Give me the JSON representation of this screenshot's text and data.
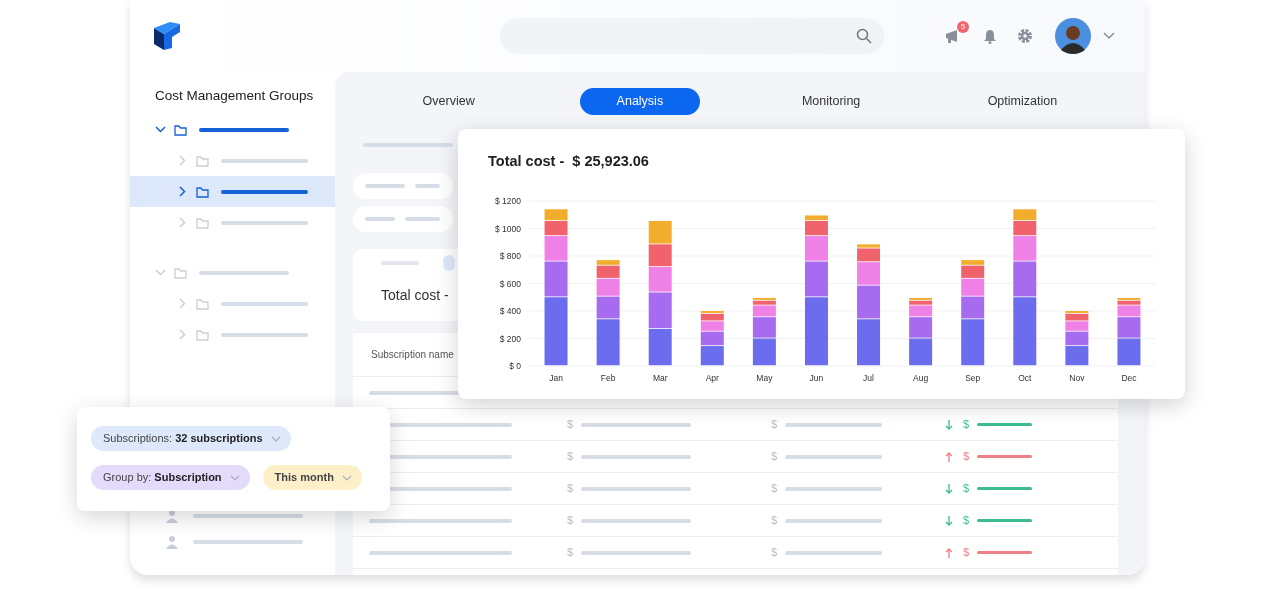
{
  "header": {
    "badge": "5"
  },
  "sidebar": {
    "title": "Cost Management Groups",
    "tree": [
      {
        "expanded": true,
        "selected": false,
        "children": [
          {
            "expanded": false,
            "selected": false
          },
          {
            "expanded": false,
            "selected": true
          },
          {
            "expanded": false,
            "selected": false
          }
        ]
      },
      {
        "expanded": true,
        "selected": false,
        "children": [
          {
            "expanded": false,
            "selected": false
          },
          {
            "expanded": false,
            "selected": false
          }
        ]
      }
    ]
  },
  "tabs": [
    {
      "label": "Overview",
      "selected": false
    },
    {
      "label": "Analysis",
      "selected": true
    },
    {
      "label": "Monitoring",
      "selected": false
    },
    {
      "label": "Optimization",
      "selected": false
    }
  ],
  "summary_card": {
    "title": "Total cost -"
  },
  "table": {
    "columns": [
      "Subscription name"
    ],
    "rows": [
      {
        "kind": "down",
        "cells": [
          "$",
          "$",
          "$"
        ]
      },
      {
        "kind": "up",
        "cells": [
          "$",
          "$",
          "$"
        ]
      },
      {
        "kind": "down",
        "cells": [
          "$",
          "$",
          "$"
        ]
      },
      {
        "kind": "down",
        "cells": [
          "$",
          "$",
          "$"
        ]
      },
      {
        "kind": "up",
        "cells": [
          "$",
          "$",
          "$"
        ]
      }
    ]
  },
  "chart_card": {
    "title": "Total cost -  $ 25,923.06",
    "chart_data": {
      "type": "bar",
      "stacked": true,
      "grid": true,
      "categories": [
        "Jan",
        "Feb",
        "Mar",
        "Apr",
        "May",
        "Jun",
        "Jul",
        "Aug",
        "Sep",
        "Oct",
        "Nov",
        "Dec"
      ],
      "ylim": [
        0,
        1200
      ],
      "yticks": [
        {
          "value": 0,
          "label": "$ 0"
        },
        {
          "value": 200,
          "label": "$ 200"
        },
        {
          "value": 400,
          "label": "$ 400"
        },
        {
          "value": 600,
          "label": "$ 600"
        },
        {
          "value": 800,
          "label": "$ 800"
        },
        {
          "value": 1000,
          "label": "$ 1000"
        },
        {
          "value": 1200,
          "label": "$ 1200"
        }
      ],
      "series": [
        {
          "color": "#6b6cee",
          "values": [
            500,
            340,
            270,
            145,
            200,
            500,
            340,
            200,
            340,
            500,
            145,
            200
          ]
        },
        {
          "color": "#a66bef",
          "values": [
            260,
            165,
            265,
            105,
            155,
            260,
            245,
            155,
            165,
            260,
            105,
            155
          ]
        },
        {
          "color": "#ef80e6",
          "values": [
            185,
            130,
            185,
            75,
            85,
            185,
            170,
            85,
            130,
            185,
            75,
            85
          ]
        },
        {
          "color": "#f0636c",
          "values": [
            110,
            95,
            165,
            55,
            35,
            110,
            100,
            35,
            95,
            110,
            55,
            35
          ]
        },
        {
          "color": "#f2ad2c",
          "values": [
            85,
            40,
            170,
            20,
            20,
            40,
            30,
            20,
            40,
            85,
            20,
            20
          ]
        }
      ]
    }
  },
  "filters": [
    {
      "text": "Subscriptions: **32 subscriptions**",
      "color": "#dde9fb"
    },
    {
      "text": "Group by: **Subscription**",
      "color": "#e4dbfa"
    },
    {
      "text": "This month",
      "color": "#fdf0c9"
    }
  ]
}
